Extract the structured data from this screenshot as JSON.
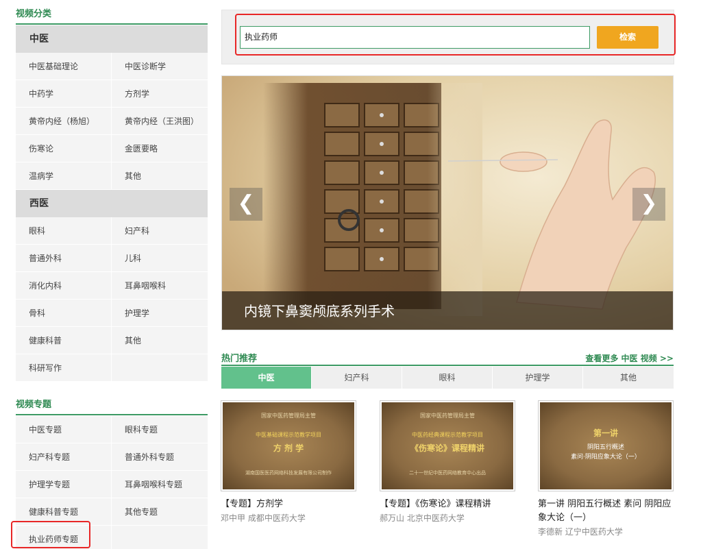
{
  "sidebar": {
    "video_category_title": "视频分类",
    "tcm": {
      "heading": "中医",
      "items": [
        "中医基础理论",
        "中医诊断学",
        "中药学",
        "方剂学",
        "黄帝内经（杨旭）",
        "黄帝内经（王洪图）",
        "伤寒论",
        "金匮要略",
        "温病学",
        "其他"
      ]
    },
    "wm": {
      "heading": "西医",
      "items": [
        "眼科",
        "妇产科",
        "普通外科",
        "儿科",
        "消化内科",
        "耳鼻咽喉科",
        "骨科",
        "护理学",
        "健康科普",
        "其他",
        "科研写作"
      ]
    },
    "topic_title": "视频专题",
    "topics": [
      "中医专题",
      "眼科专题",
      "妇产科专题",
      "普通外科专题",
      "护理学专题",
      "耳鼻咽喉科专题",
      "健康科普专题",
      "其他专题",
      "执业药师专题"
    ]
  },
  "search": {
    "value": "执业药师",
    "button_label": "检索"
  },
  "banner": {
    "caption": "内镜下鼻窦颅底系列手术",
    "prev_icon": "chevron-left-icon",
    "next_icon": "chevron-right-icon"
  },
  "hot": {
    "title": "热门推荐",
    "more_link": "查看更多 中医 视频 >>",
    "tabs": [
      "中医",
      "妇产科",
      "眼科",
      "护理学",
      "其他"
    ],
    "active_tab": "中医"
  },
  "videos": [
    {
      "title": "【专题】方剂学",
      "meta": "邓中甲  成都中医药大学",
      "thumb": [
        "国家中医药管理局主管",
        "中医基础课程示范教学项目",
        "方 剂 学",
        "湖南国医医药网络科技发展有限公司制作"
      ]
    },
    {
      "title": "【专题】《伤寒论》课程精讲",
      "meta": "郝万山  北京中医药大学",
      "thumb": [
        "国家中医药管理局主管",
        "中医药经典课程示范教学项目",
        "《伤寒论》课程精讲",
        "二十一世纪中医药网络教育中心出品"
      ]
    },
    {
      "title": "第一讲 阴阳五行概述 素问 阴阳应象大论（一）",
      "meta": "李德新  辽宁中医药大学",
      "thumb": [
        "",
        "第一讲",
        "阴阳五行概述",
        "素问·阴阳应象大论（一）"
      ]
    }
  ]
}
